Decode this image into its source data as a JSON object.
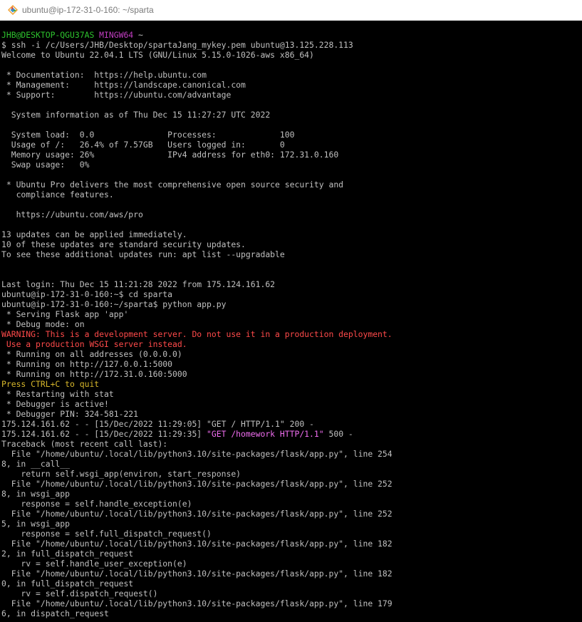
{
  "window": {
    "title": "ubuntu@ip-172-31-0-160: ~/sparta",
    "icon": "git-bash-diamond-icon"
  },
  "colors": {
    "prompt_user": "#2ec42e",
    "prompt_shell": "#c33ec3",
    "warning": "#ff4a4a",
    "quit_hint": "#d7b72b",
    "error_request": "#f06ef0",
    "default_text": "#c0c0c0",
    "background": "#000000"
  },
  "terminal": {
    "lines": [
      {
        "segments": [
          {
            "text": "JHB@DESKTOP-QGU37AS ",
            "color": "green"
          },
          {
            "text": "MINGW64",
            "color": "magenta"
          },
          {
            "text": " ~",
            "color": "default"
          }
        ]
      },
      {
        "segments": [
          {
            "text": "$ ssh -i /c/Users/JHB/Desktop/spartaJang_mykey.pem ubuntu@13.125.228.113",
            "color": "default"
          }
        ]
      },
      {
        "segments": [
          {
            "text": "Welcome to Ubuntu 22.04.1 LTS (GNU/Linux 5.15.0-1026-aws x86_64)",
            "color": "default"
          }
        ]
      },
      {
        "segments": [
          {
            "text": "",
            "color": "default"
          }
        ]
      },
      {
        "segments": [
          {
            "text": " * Documentation:  https://help.ubuntu.com",
            "color": "default"
          }
        ]
      },
      {
        "segments": [
          {
            "text": " * Management:     https://landscape.canonical.com",
            "color": "default"
          }
        ]
      },
      {
        "segments": [
          {
            "text": " * Support:        https://ubuntu.com/advantage",
            "color": "default"
          }
        ]
      },
      {
        "segments": [
          {
            "text": "",
            "color": "default"
          }
        ]
      },
      {
        "segments": [
          {
            "text": "  System information as of Thu Dec 15 11:27:27 UTC 2022",
            "color": "default"
          }
        ]
      },
      {
        "segments": [
          {
            "text": "",
            "color": "default"
          }
        ]
      },
      {
        "segments": [
          {
            "text": "  System load:  0.0               Processes:             100",
            "color": "default"
          }
        ]
      },
      {
        "segments": [
          {
            "text": "  Usage of /:   26.4% of 7.57GB   Users logged in:       0",
            "color": "default"
          }
        ]
      },
      {
        "segments": [
          {
            "text": "  Memory usage: 26%               IPv4 address for eth0: 172.31.0.160",
            "color": "default"
          }
        ]
      },
      {
        "segments": [
          {
            "text": "  Swap usage:   0%",
            "color": "default"
          }
        ]
      },
      {
        "segments": [
          {
            "text": "",
            "color": "default"
          }
        ]
      },
      {
        "segments": [
          {
            "text": " * Ubuntu Pro delivers the most comprehensive open source security and",
            "color": "default"
          }
        ]
      },
      {
        "segments": [
          {
            "text": "   compliance features.",
            "color": "default"
          }
        ]
      },
      {
        "segments": [
          {
            "text": "",
            "color": "default"
          }
        ]
      },
      {
        "segments": [
          {
            "text": "   https://ubuntu.com/aws/pro",
            "color": "default"
          }
        ]
      },
      {
        "segments": [
          {
            "text": "",
            "color": "default"
          }
        ]
      },
      {
        "segments": [
          {
            "text": "13 updates can be applied immediately.",
            "color": "default"
          }
        ]
      },
      {
        "segments": [
          {
            "text": "10 of these updates are standard security updates.",
            "color": "default"
          }
        ]
      },
      {
        "segments": [
          {
            "text": "To see these additional updates run: apt list --upgradable",
            "color": "default"
          }
        ]
      },
      {
        "segments": [
          {
            "text": "",
            "color": "default"
          }
        ]
      },
      {
        "segments": [
          {
            "text": "",
            "color": "default"
          }
        ]
      },
      {
        "segments": [
          {
            "text": "Last login: Thu Dec 15 11:21:28 2022 from 175.124.161.62",
            "color": "default"
          }
        ]
      },
      {
        "segments": [
          {
            "text": "ubuntu@ip-172-31-0-160:~$ cd sparta",
            "color": "default"
          }
        ]
      },
      {
        "segments": [
          {
            "text": "ubuntu@ip-172-31-0-160:~/sparta$ python app.py",
            "color": "default"
          }
        ]
      },
      {
        "segments": [
          {
            "text": " * Serving Flask app 'app'",
            "color": "default"
          }
        ]
      },
      {
        "segments": [
          {
            "text": " * Debug mode: on",
            "color": "default"
          }
        ]
      },
      {
        "segments": [
          {
            "text": "WARNING: This is a development server. Do not use it in a production deployment.",
            "color": "red"
          }
        ]
      },
      {
        "segments": [
          {
            "text": " Use a production WSGI server instead.",
            "color": "red"
          }
        ]
      },
      {
        "segments": [
          {
            "text": " * Running on all addresses (0.0.0.0)",
            "color": "default"
          }
        ]
      },
      {
        "segments": [
          {
            "text": " * Running on http://127.0.0.1:5000",
            "color": "default"
          }
        ]
      },
      {
        "segments": [
          {
            "text": " * Running on http://172.31.0.160:5000",
            "color": "default"
          }
        ]
      },
      {
        "segments": [
          {
            "text": "Press CTRL+C to quit",
            "color": "yellow"
          }
        ]
      },
      {
        "segments": [
          {
            "text": " * Restarting with stat",
            "color": "default"
          }
        ]
      },
      {
        "segments": [
          {
            "text": " * Debugger is active!",
            "color": "default"
          }
        ]
      },
      {
        "segments": [
          {
            "text": " * Debugger PIN: 324-581-221",
            "color": "default"
          }
        ]
      },
      {
        "segments": [
          {
            "text": "175.124.161.62 - - [15/Dec/2022 11:29:05] \"GET / HTTP/1.1\" 200 -",
            "color": "default"
          }
        ]
      },
      {
        "segments": [
          {
            "text": "175.124.161.62 - - [15/Dec/2022 11:29:35] ",
            "color": "default"
          },
          {
            "text": "\"GET /homework HTTP/1.1\"",
            "color": "pink"
          },
          {
            "text": " 500 -",
            "color": "default"
          }
        ]
      },
      {
        "segments": [
          {
            "text": "Traceback (most recent call last):",
            "color": "default"
          }
        ]
      },
      {
        "segments": [
          {
            "text": "  File \"/home/ubuntu/.local/lib/python3.10/site-packages/flask/app.py\", line 254",
            "color": "default"
          }
        ]
      },
      {
        "segments": [
          {
            "text": "8, in __call__",
            "color": "default"
          }
        ]
      },
      {
        "segments": [
          {
            "text": "    return self.wsgi_app(environ, start_response)",
            "color": "default"
          }
        ]
      },
      {
        "segments": [
          {
            "text": "  File \"/home/ubuntu/.local/lib/python3.10/site-packages/flask/app.py\", line 252",
            "color": "default"
          }
        ]
      },
      {
        "segments": [
          {
            "text": "8, in wsgi_app",
            "color": "default"
          }
        ]
      },
      {
        "segments": [
          {
            "text": "    response = self.handle_exception(e)",
            "color": "default"
          }
        ]
      },
      {
        "segments": [
          {
            "text": "  File \"/home/ubuntu/.local/lib/python3.10/site-packages/flask/app.py\", line 252",
            "color": "default"
          }
        ]
      },
      {
        "segments": [
          {
            "text": "5, in wsgi_app",
            "color": "default"
          }
        ]
      },
      {
        "segments": [
          {
            "text": "    response = self.full_dispatch_request()",
            "color": "default"
          }
        ]
      },
      {
        "segments": [
          {
            "text": "  File \"/home/ubuntu/.local/lib/python3.10/site-packages/flask/app.py\", line 182",
            "color": "default"
          }
        ]
      },
      {
        "segments": [
          {
            "text": "2, in full_dispatch_request",
            "color": "default"
          }
        ]
      },
      {
        "segments": [
          {
            "text": "    rv = self.handle_user_exception(e)",
            "color": "default"
          }
        ]
      },
      {
        "segments": [
          {
            "text": "  File \"/home/ubuntu/.local/lib/python3.10/site-packages/flask/app.py\", line 182",
            "color": "default"
          }
        ]
      },
      {
        "segments": [
          {
            "text": "0, in full_dispatch_request",
            "color": "default"
          }
        ]
      },
      {
        "segments": [
          {
            "text": "    rv = self.dispatch_request()",
            "color": "default"
          }
        ]
      },
      {
        "segments": [
          {
            "text": "  File \"/home/ubuntu/.local/lib/python3.10/site-packages/flask/app.py\", line 179",
            "color": "default"
          }
        ]
      },
      {
        "segments": [
          {
            "text": "6, in dispatch_request",
            "color": "default"
          }
        ]
      }
    ]
  }
}
